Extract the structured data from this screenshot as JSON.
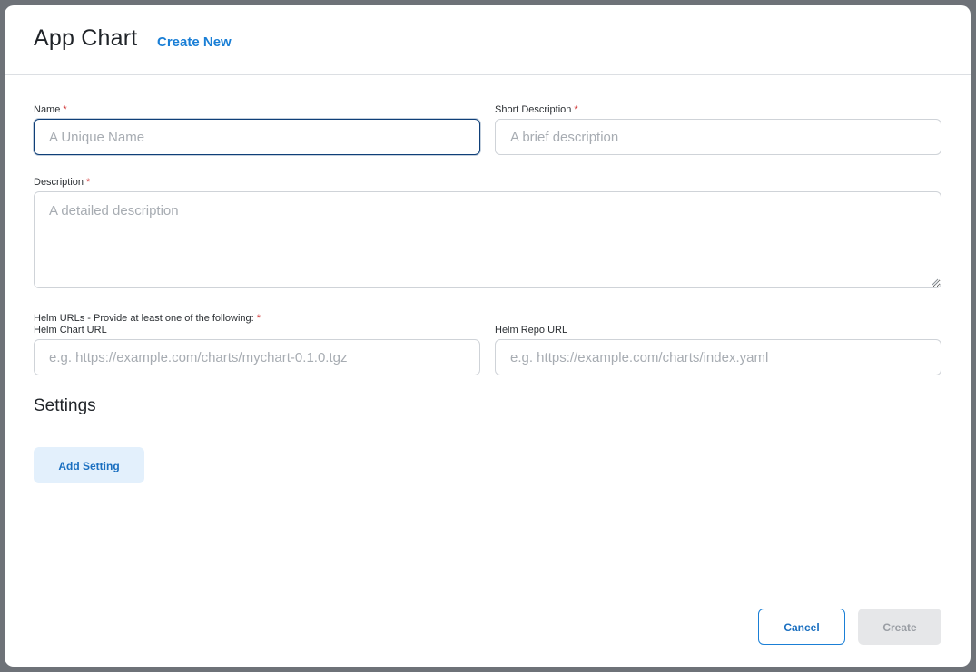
{
  "dialog": {
    "title": "App Chart",
    "subtitle": "Create New"
  },
  "form": {
    "name": {
      "label": "Name",
      "required_mark": "*",
      "placeholder": "A Unique Name",
      "value": ""
    },
    "short_description": {
      "label": "Short Description",
      "required_mark": "*",
      "placeholder": "A brief description",
      "value": ""
    },
    "description": {
      "label": "Description",
      "required_mark": "*",
      "placeholder": "A detailed description",
      "value": ""
    },
    "helm_urls": {
      "label": "Helm URLs - Provide at least one of the following:",
      "required_mark": "*"
    },
    "helm_chart_url": {
      "label": "Helm Chart URL",
      "placeholder": "e.g. https://example.com/charts/mychart-0.1.0.tgz",
      "value": ""
    },
    "helm_repo_url": {
      "label": "Helm Repo URL",
      "placeholder": "e.g. https://example.com/charts/index.yaml",
      "value": ""
    }
  },
  "settings": {
    "title": "Settings",
    "add_label": "Add Setting"
  },
  "footer": {
    "cancel_label": "Cancel",
    "create_label": "Create"
  },
  "colors": {
    "accent": "#1a7fd6",
    "focus_border": "#0f3f78",
    "required": "#d23b3b",
    "disabled_bg": "#e6e7e9"
  },
  "icons": [
    "resize-handle-icon"
  ]
}
